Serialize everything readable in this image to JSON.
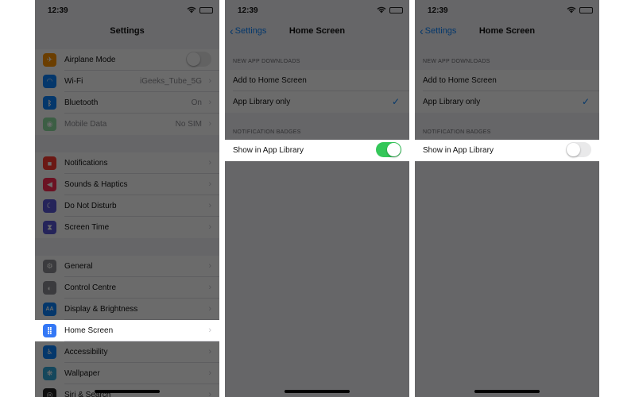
{
  "status": {
    "time": "12:39"
  },
  "phone1": {
    "title": "Settings",
    "group1": [
      {
        "label": "Airplane Mode",
        "icon": "airplane-icon",
        "color": "#ff9500",
        "glyph": "✈"
      },
      {
        "label": "Wi-Fi",
        "value": "iGeeks_Tube_5G",
        "icon": "wifi-icon",
        "color": "#0a84ff",
        "glyph": "◠"
      },
      {
        "label": "Bluetooth",
        "value": "On",
        "icon": "bluetooth-icon",
        "color": "#0a84ff",
        "glyph": "ᛒ"
      },
      {
        "label": "Mobile Data",
        "value": "No SIM",
        "icon": "antenna-icon",
        "color": "#34c759",
        "glyph": "◉"
      }
    ],
    "group2": [
      {
        "label": "Notifications",
        "icon": "notifications-icon",
        "color": "#ff3b30",
        "glyph": "■"
      },
      {
        "label": "Sounds & Haptics",
        "icon": "speaker-icon",
        "color": "#ff2d55",
        "glyph": "◀"
      },
      {
        "label": "Do Not Disturb",
        "icon": "moon-icon",
        "color": "#5856d6",
        "glyph": "☾"
      },
      {
        "label": "Screen Time",
        "icon": "hourglass-icon",
        "color": "#5856d6",
        "glyph": "⧗"
      }
    ],
    "group3": [
      {
        "label": "General",
        "icon": "gear-icon",
        "color": "#8e8e93",
        "glyph": "⚙"
      },
      {
        "label": "Control Centre",
        "icon": "control-centre-icon",
        "color": "#8e8e93",
        "glyph": "◐"
      },
      {
        "label": "Display & Brightness",
        "icon": "display-icon",
        "color": "#0a84ff",
        "glyph": "AA"
      },
      {
        "label": "Home Screen",
        "icon": "home-screen-icon",
        "color": "#3478f6",
        "glyph": "⣿"
      },
      {
        "label": "Accessibility",
        "icon": "accessibility-icon",
        "color": "#0a84ff",
        "glyph": "♿"
      },
      {
        "label": "Wallpaper",
        "icon": "wallpaper-icon",
        "color": "#34aadc",
        "glyph": "❋"
      },
      {
        "label": "Siri & Search",
        "icon": "siri-icon",
        "color": "#222222",
        "glyph": "◎"
      }
    ]
  },
  "home_screen": {
    "back_label": "Settings",
    "title": "Home Screen",
    "section_downloads": "NEW APP DOWNLOADS",
    "option_add": "Add to Home Screen",
    "option_library": "App Library only",
    "section_badges": "NOTIFICATION BADGES",
    "badges_label": "Show in App Library"
  },
  "colors": {
    "accent": "#0a84ff",
    "toggle_on": "#34c759"
  }
}
